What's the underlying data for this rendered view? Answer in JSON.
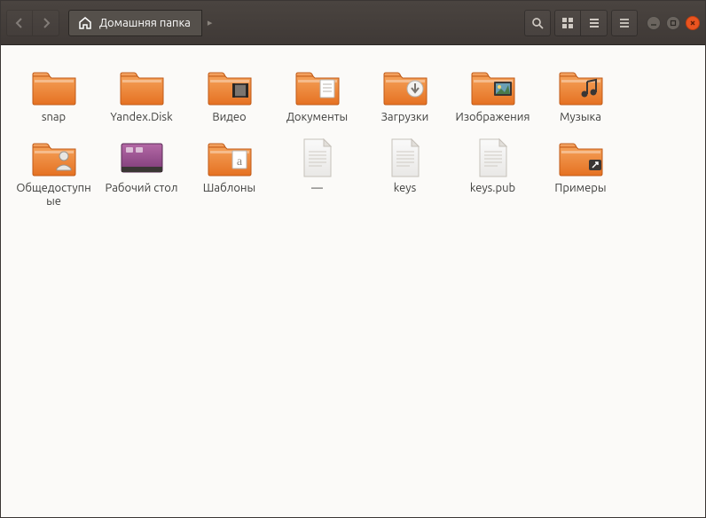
{
  "location_label": "Домашняя папка",
  "items": [
    {
      "name": "snap",
      "type": "folder",
      "overlay": null
    },
    {
      "name": "Yandex.Disk",
      "type": "folder",
      "overlay": null
    },
    {
      "name": "Видео",
      "type": "folder",
      "overlay": "videos"
    },
    {
      "name": "Документы",
      "type": "folder",
      "overlay": "documents"
    },
    {
      "name": "Загрузки",
      "type": "folder",
      "overlay": "downloads"
    },
    {
      "name": "Изображения",
      "type": "folder",
      "overlay": "pictures"
    },
    {
      "name": "Музыка",
      "type": "folder",
      "overlay": "music"
    },
    {
      "name": "Общедоступные",
      "type": "folder",
      "overlay": "public"
    },
    {
      "name": "Рабочий стол",
      "type": "desktop",
      "overlay": null
    },
    {
      "name": "Шаблоны",
      "type": "folder",
      "overlay": "templates"
    },
    {
      "name": "—",
      "type": "file",
      "overlay": null
    },
    {
      "name": "keys",
      "type": "file",
      "overlay": null
    },
    {
      "name": "keys.pub",
      "type": "file",
      "overlay": null
    },
    {
      "name": "Примеры",
      "type": "folder",
      "overlay": "link"
    }
  ]
}
